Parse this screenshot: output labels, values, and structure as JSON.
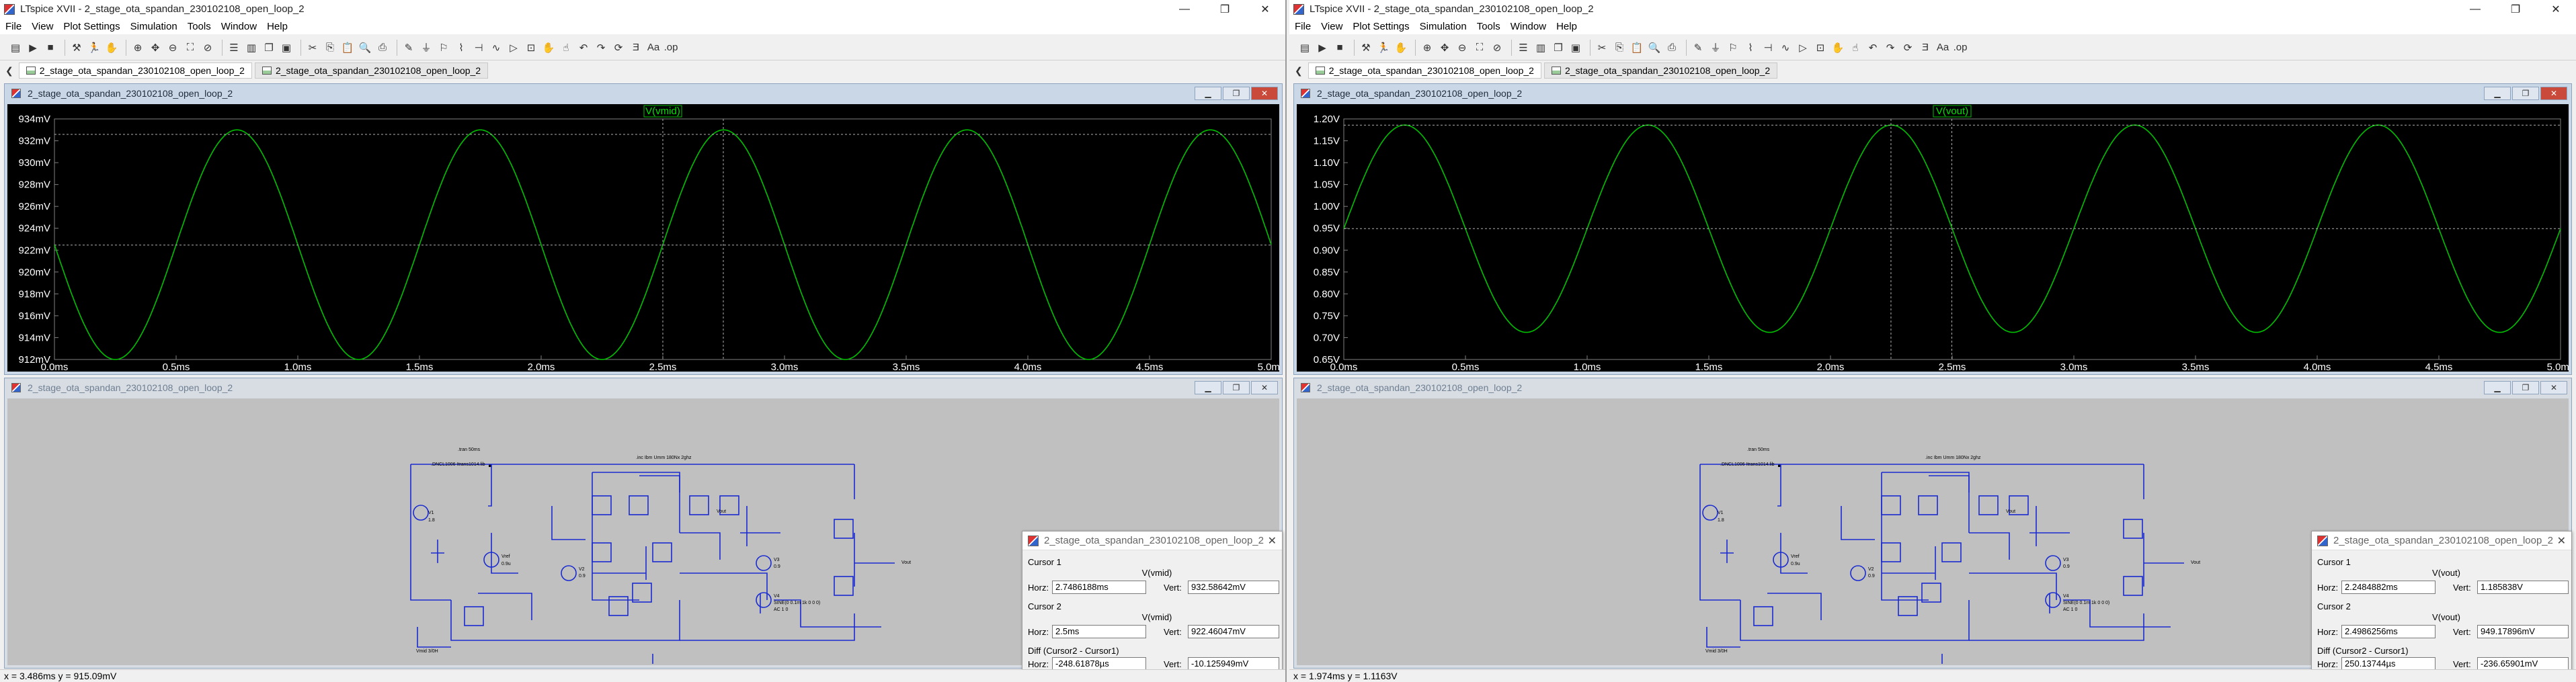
{
  "apps": [
    {
      "title": "LTspice XVII - 2_stage_ota_spandan_230102108_open_loop_2",
      "window_controls": [
        "—",
        "❐",
        "✕"
      ],
      "menus": [
        "File",
        "View",
        "Plot Settings",
        "Simulation",
        "Tools",
        "Window",
        "Help"
      ],
      "tabs": [
        {
          "label": "2_stage_ota_spandan_230102108_open_loop_2",
          "active": true
        },
        {
          "label": "2_stage_ota_spandan_230102108_open_loop_2",
          "active": false
        }
      ],
      "plot_window_title": "2_stage_ota_spandan_230102108_open_loop_2",
      "schematic_window_title": "2_stage_ota_spandan_230102108_open_loop_2",
      "cursor_window": {
        "title": "2_stage_ota_spandan_230102108_open_loop_2",
        "cursor1_label": "Cursor 1",
        "cursor1_trace": "V(vmid)",
        "cursor1_horz": "2.7486188ms",
        "cursor1_vert": "932.58642mV",
        "cursor2_label": "Cursor 2",
        "cursor2_trace": "V(vmid)",
        "cursor2_horz": "2.5ms",
        "cursor2_vert": "922.46047mV",
        "diff_label": "Diff (Cursor2 - Cursor1)",
        "diff_horz": "-248.61878µs",
        "diff_vert": "-10.125949mV",
        "horz_label": "Horz:",
        "vert_label": "Vert:"
      },
      "status": "x = 3.486ms   y = 915.09mV",
      "chart_data": {
        "type": "line",
        "title": "V(vmid)",
        "series": [
          {
            "name": "V(vmid)",
            "color": "#00c000",
            "amplitude_mV": 10.5,
            "offset_mV": 922.5,
            "period_ms": 1.0,
            "peak_at_ms": 0.75
          }
        ],
        "xlim": [
          0,
          5
        ],
        "x_unit": "ms",
        "x_ticks": [
          "0.0ms",
          "0.5ms",
          "1.0ms",
          "1.5ms",
          "2.0ms",
          "2.5ms",
          "3.0ms",
          "3.5ms",
          "4.0ms",
          "4.5ms",
          "5.0ms"
        ],
        "ylim": [
          912,
          934
        ],
        "y_unit": "mV",
        "y_ticks": [
          "934mV",
          "932mV",
          "930mV",
          "928mV",
          "926mV",
          "924mV",
          "922mV",
          "920mV",
          "918mV",
          "916mV",
          "914mV",
          "912mV"
        ],
        "cursors": {
          "c1_x": 2.7486,
          "c1_y": 932.586,
          "c2_x": 2.5,
          "c2_y": 922.46
        },
        "grid": false,
        "background": "#000000"
      }
    },
    {
      "title": "LTspice XVII - 2_stage_ota_spandan_230102108_open_loop_2",
      "window_controls": [
        "—",
        "❐",
        "✕"
      ],
      "menus": [
        "File",
        "View",
        "Plot Settings",
        "Simulation",
        "Tools",
        "Window",
        "Help"
      ],
      "tabs": [
        {
          "label": "2_stage_ota_spandan_230102108_open_loop_2",
          "active": true
        },
        {
          "label": "2_stage_ota_spandan_230102108_open_loop_2",
          "active": false
        }
      ],
      "plot_window_title": "2_stage_ota_spandan_230102108_open_loop_2",
      "schematic_window_title": "2_stage_ota_spandan_230102108_open_loop_2",
      "cursor_window": {
        "title": "2_stage_ota_spandan_230102108_open_loop_2",
        "cursor1_label": "Cursor 1",
        "cursor1_trace": "V(vout)",
        "cursor1_horz": "2.2484882ms",
        "cursor1_vert": "1.185838V",
        "cursor2_label": "Cursor 2",
        "cursor2_trace": "V(vout)",
        "cursor2_horz": "2.4986256ms",
        "cursor2_vert": "949.17896mV",
        "diff_label": "Diff (Cursor2 - Cursor1)",
        "diff_horz": "250.13744µs",
        "diff_vert": "-236.65901mV",
        "horz_label": "Horz:",
        "vert_label": "Vert:"
      },
      "status": "x = 1.974ms   y = 1.1163V",
      "chart_data": {
        "type": "line",
        "title": "V(vout)",
        "series": [
          {
            "name": "V(vout)",
            "color": "#00c000",
            "amplitude": 0.237,
            "offset": 0.949,
            "period_ms": 1.0,
            "peak_at_ms": 0.25
          }
        ],
        "xlim": [
          0,
          5
        ],
        "x_unit": "ms",
        "x_ticks": [
          "0.0ms",
          "0.5ms",
          "1.0ms",
          "1.5ms",
          "2.0ms",
          "2.5ms",
          "3.0ms",
          "3.5ms",
          "4.0ms",
          "4.5ms",
          "5.0ms"
        ],
        "ylim": [
          0.65,
          1.2
        ],
        "y_unit": "V",
        "y_ticks": [
          "1.20V",
          "1.15V",
          "1.10V",
          "1.05V",
          "1.00V",
          "0.95V",
          "0.90V",
          "0.85V",
          "0.80V",
          "0.75V",
          "0.70V",
          "0.65V"
        ],
        "cursors": {
          "c1_x": 2.2485,
          "c1_y": 1.1858,
          "c2_x": 2.4986,
          "c2_y": 0.9492
        },
        "grid": false,
        "background": "#000000"
      }
    }
  ]
}
